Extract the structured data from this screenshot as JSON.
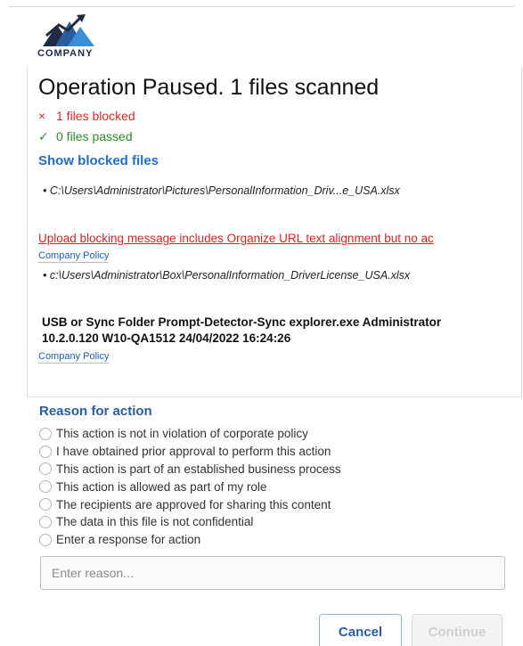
{
  "logo": {
    "text": "COMPANY",
    "icon": "mountain-logo-icon"
  },
  "header": {
    "title": "Operation Paused. 1 files scanned"
  },
  "status": {
    "blocked_mark": "×",
    "blocked_text": "1 files blocked",
    "passed_mark": "✓",
    "passed_text": "0 files passed"
  },
  "show_blocked_label": "Show blocked files",
  "files": {
    "first": "• C:\\Users\\Administrator\\Pictures\\PersonalInformation_Driv...e_USA.xlsx",
    "second": "• c:\\Users\\Administrator\\Box\\PersonalInformation_DriverLicense_USA.xlsx"
  },
  "warning_link": "Upload blocking message includes Organize URL text alignment but no ac",
  "policy_link_1": "Company Policy",
  "detector": {
    "line1": "USB or Sync Folder Prompt-Detector-Sync explorer.exe Administrator",
    "line2": "10.2.0.120 W10-QA1512 24/04/2022 16:24:26"
  },
  "policy_link_2": "Company Policy",
  "reason": {
    "title": "Reason for action",
    "options": [
      "This action is not in violation of corporate policy",
      "I have obtained prior approval to perform this action",
      "This action is part of an established business process",
      "This action is allowed as part of my role",
      "The recipients are approved for sharing this content",
      "The data in this file is not confidential",
      "Enter a response for action"
    ],
    "input_placeholder": "Enter reason..."
  },
  "buttons": {
    "cancel": "Cancel",
    "continue": "Continue"
  },
  "colors": {
    "blocked": "#d22b2b",
    "passed": "#2e8b2e",
    "link": "#1f6fc8",
    "reason_title": "#2a5ea0",
    "warning": "#e02020"
  }
}
